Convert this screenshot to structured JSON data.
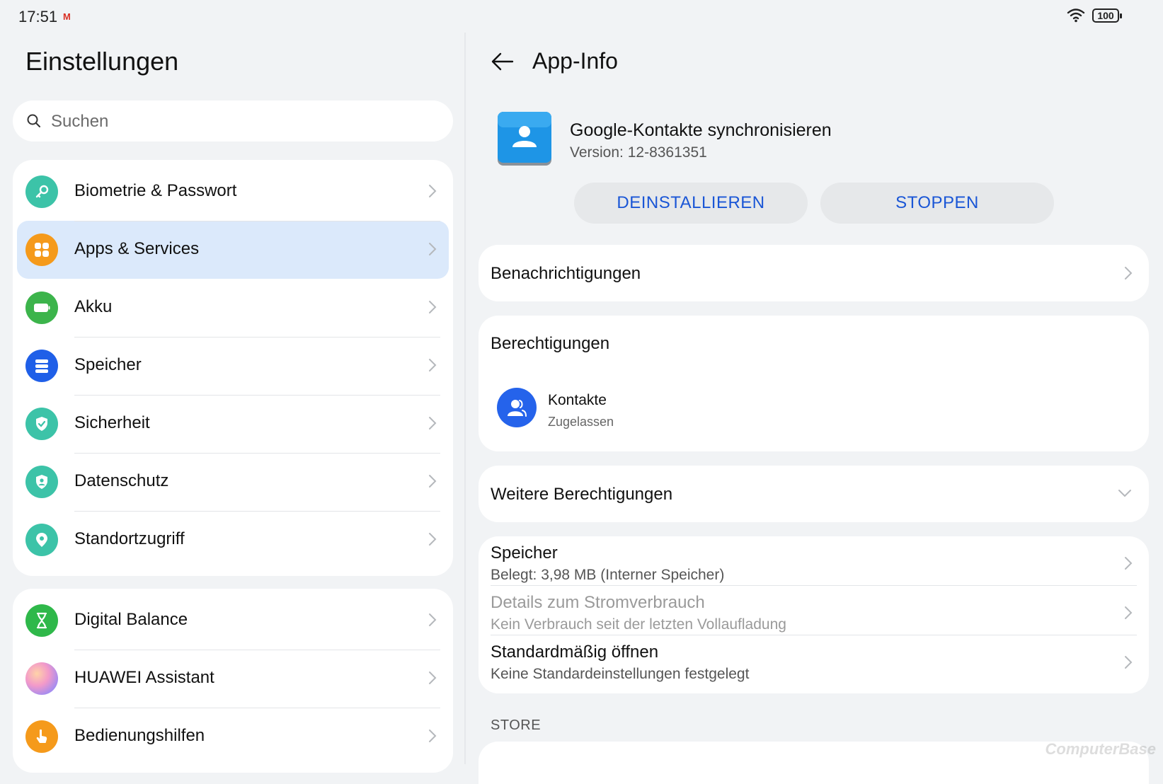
{
  "status_bar": {
    "time": "17:51",
    "notification": "M",
    "battery": "100"
  },
  "left_pane": {
    "title": "Einstellungen",
    "search_placeholder": "Suchen",
    "group1": [
      {
        "label": "Biometrie & Passwort",
        "icon": "key-icon",
        "color": "#3cc3a8"
      },
      {
        "label": "Apps & Services",
        "icon": "apps-grid-icon",
        "color": "#f59a1b",
        "active": true
      },
      {
        "label": "Akku",
        "icon": "battery-icon",
        "color": "#3cb44b"
      },
      {
        "label": "Speicher",
        "icon": "storage-icon",
        "color": "#1f5fe8"
      },
      {
        "label": "Sicherheit",
        "icon": "shield-check-icon",
        "color": "#3cc3a8"
      },
      {
        "label": "Datenschutz",
        "icon": "privacy-shield-icon",
        "color": "#3cc3a8"
      },
      {
        "label": "Standortzugriff",
        "icon": "location-pin-icon",
        "color": "#3cc3a8"
      }
    ],
    "group2": [
      {
        "label": "Digital Balance",
        "icon": "hourglass-icon",
        "color": "#2fb84a"
      },
      {
        "label": "HUAWEI Assistant",
        "icon": "assistant-orb-icon",
        "color": "#c7a8f0"
      },
      {
        "label": "Bedienungshilfen",
        "icon": "hand-pointer-icon",
        "color": "#f59a1b"
      }
    ]
  },
  "right_pane": {
    "title": "App-Info",
    "app": {
      "name": "Google-Kontakte synchronisieren",
      "version": "Version: 12-8361351"
    },
    "buttons": {
      "uninstall": "DEINSTALLIEREN",
      "stop": "STOPPEN"
    },
    "notifications": "Benachrichtigungen",
    "permissions": {
      "header": "Berechtigungen",
      "item_title": "Kontakte",
      "item_status": "Zugelassen"
    },
    "more_permissions": "Weitere Berechtigungen",
    "storage": {
      "title": "Speicher",
      "subtitle": "Belegt: 3,98 MB (Interner Speicher)"
    },
    "power": {
      "title": "Details zum Stromverbrauch",
      "subtitle": "Kein Verbrauch seit der letzten Vollaufladung"
    },
    "default_open": {
      "title": "Standardmäßig öffnen",
      "subtitle": "Keine Standardeinstellungen festgelegt"
    },
    "store_label": "STORE"
  },
  "watermark": "ComputerBase",
  "colors": {
    "accent_blue": "#1a56d6",
    "background": "#f1f3f5",
    "active_row": "#dbe9fb"
  }
}
